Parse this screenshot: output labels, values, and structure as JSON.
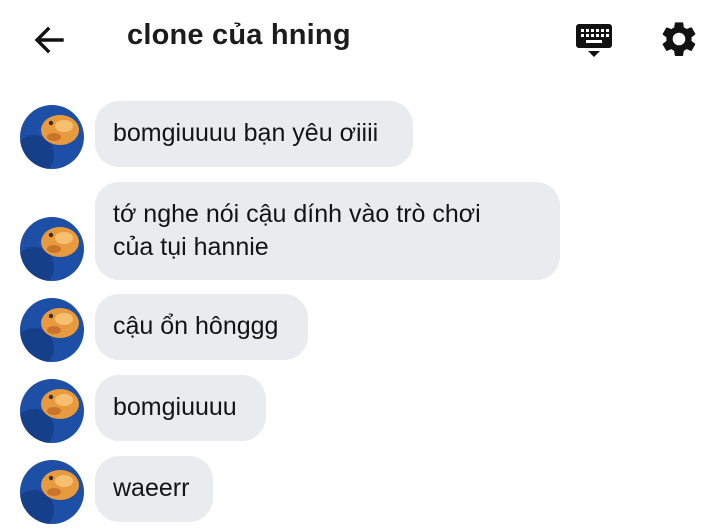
{
  "header": {
    "title": "clone của hning"
  },
  "messages": [
    {
      "lines": [
        "bomgiuuuu bạn yêu ơiiii"
      ]
    },
    {
      "lines": [
        "tớ nghe nói cậu dính vào trò chơi",
        "của tụi hannie"
      ]
    },
    {
      "lines": [
        "cậu ổn hônggg"
      ]
    },
    {
      "lines": [
        "bomgiuuuu"
      ]
    },
    {
      "lines": [
        "waeerr"
      ]
    }
  ],
  "colors": {
    "bubble": "#e9ebef",
    "text": "#141414",
    "avatar_bg": "#1d4fa6"
  },
  "icons": [
    "back-arrow-icon",
    "keyboard-icon",
    "gear-icon"
  ]
}
